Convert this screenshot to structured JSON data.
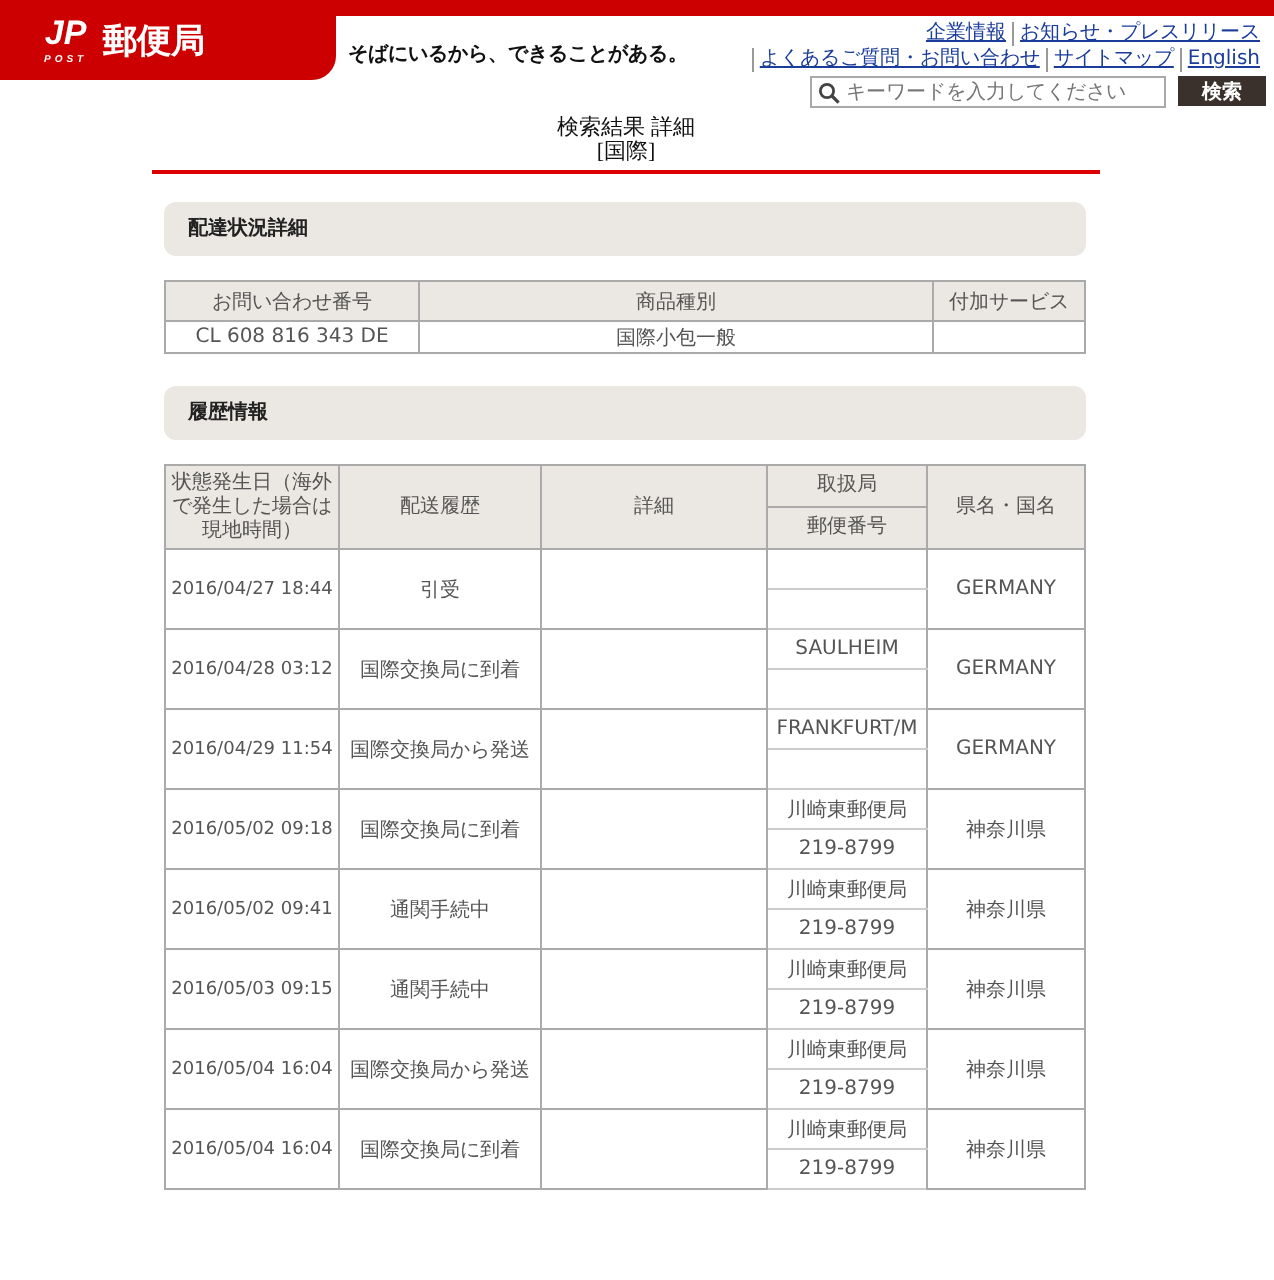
{
  "header": {
    "logo": {
      "mark": "JP",
      "sub": "POST",
      "name": "郵便局"
    },
    "tagline": "そばにいるから、できることがある。",
    "links": [
      "企業情報",
      "お知らせ・プレスリリース",
      "よくあるご質問・お問い合わせ",
      "サイトマップ",
      "English"
    ],
    "search": {
      "placeholder": "キーワードを入力してください",
      "button": "検索"
    }
  },
  "title": [
    "検索結果 詳細",
    "[国際]"
  ],
  "status_section": {
    "heading": "配達状況詳細",
    "columns": [
      "お問い合わせ番号",
      "商品種別",
      "付加サービス"
    ],
    "row": {
      "number": "CL 608 816 343 DE",
      "type": "国際小包一般"
    }
  },
  "history_section": {
    "heading": "履歴情報",
    "columns": [
      "状態発生日（海外で発生した場合は現地時間）",
      "配送履歴",
      "詳細",
      "取扱局",
      "郵便番号",
      "県名・国名"
    ],
    "rows": [
      {
        "date": "2016/04/27 18:44",
        "event": "引受",
        "region": "GERMANY"
      },
      {
        "date": "2016/04/28 03:12",
        "event": "国際交換局に到着",
        "office": "SAULHEIM",
        "region": "GERMANY"
      },
      {
        "date": "2016/04/29 11:54",
        "event": "国際交換局から発送",
        "office": "FRANKFURT/M",
        "region": "GERMANY"
      },
      {
        "date": "2016/05/02 09:18",
        "event": "国際交換局に到着",
        "office": "川崎東郵便局",
        "postcode": "219-8799",
        "region": "神奈川県"
      },
      {
        "date": "2016/05/02 09:41",
        "event": "通関手続中",
        "office": "川崎東郵便局",
        "postcode": "219-8799",
        "region": "神奈川県"
      },
      {
        "date": "2016/05/03 09:15",
        "event": "通関手続中",
        "office": "川崎東郵便局",
        "postcode": "219-8799",
        "region": "神奈川県"
      },
      {
        "date": "2016/05/04 16:04",
        "event": "国際交換局から発送",
        "office": "川崎東郵便局",
        "postcode": "219-8799",
        "region": "神奈川県"
      },
      {
        "date": "2016/05/04 16:04",
        "event": "国際交換局に到着",
        "office": "川崎東郵便局",
        "postcode": "219-8799",
        "region": "神奈川県"
      }
    ]
  }
}
